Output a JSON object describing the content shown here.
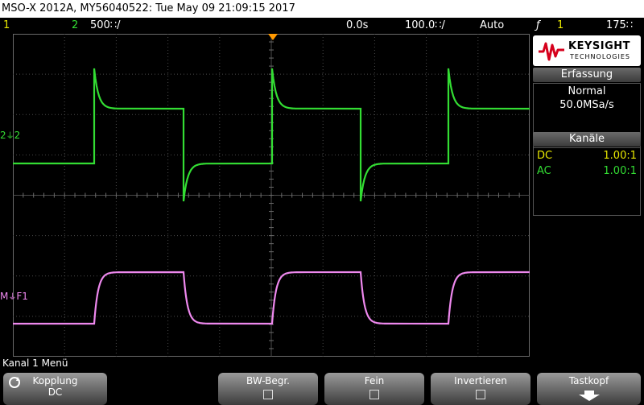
{
  "title": "MSO-X 2012A, MY56040522: Tue May 09 21:09:15 2017",
  "status": {
    "ch1_num": "1",
    "ch2_num": "2",
    "ch2_scale": "500∷/",
    "time_delay": "0.0s",
    "time_base": "100.0∷/",
    "trigger_mode": "Auto",
    "trigger_icon": "ƒ",
    "trigger_source": "1",
    "trigger_level": "175∷"
  },
  "colors": {
    "ch1": "#e8e800",
    "ch2": "#33dd33",
    "math": "#ee88ee",
    "grid": "#555555",
    "accent": "#ff9900"
  },
  "logo": {
    "brand": "KEYSIGHT",
    "sub": "TECHNOLOGIES"
  },
  "acquisition": {
    "header": "Erfassung",
    "mode": "Normal",
    "rate": "50.0MSa/s"
  },
  "channels": {
    "header": "Kanäle",
    "rows": [
      {
        "coupling": "DC",
        "ratio": "1.00:1"
      },
      {
        "coupling": "AC",
        "ratio": "1.00:1"
      }
    ]
  },
  "markers": {
    "ch2": "2",
    "ch2_tag": "2",
    "math": "M",
    "math_tag": "F1"
  },
  "menu": {
    "title": "Kanal 1 Menü",
    "keys": [
      {
        "label": "Kopplung",
        "value": "DC"
      },
      {
        "label": "BW-Begr."
      },
      {
        "label": "Fein"
      },
      {
        "label": "Invertieren"
      },
      {
        "label": "Tastkopf"
      }
    ]
  }
}
